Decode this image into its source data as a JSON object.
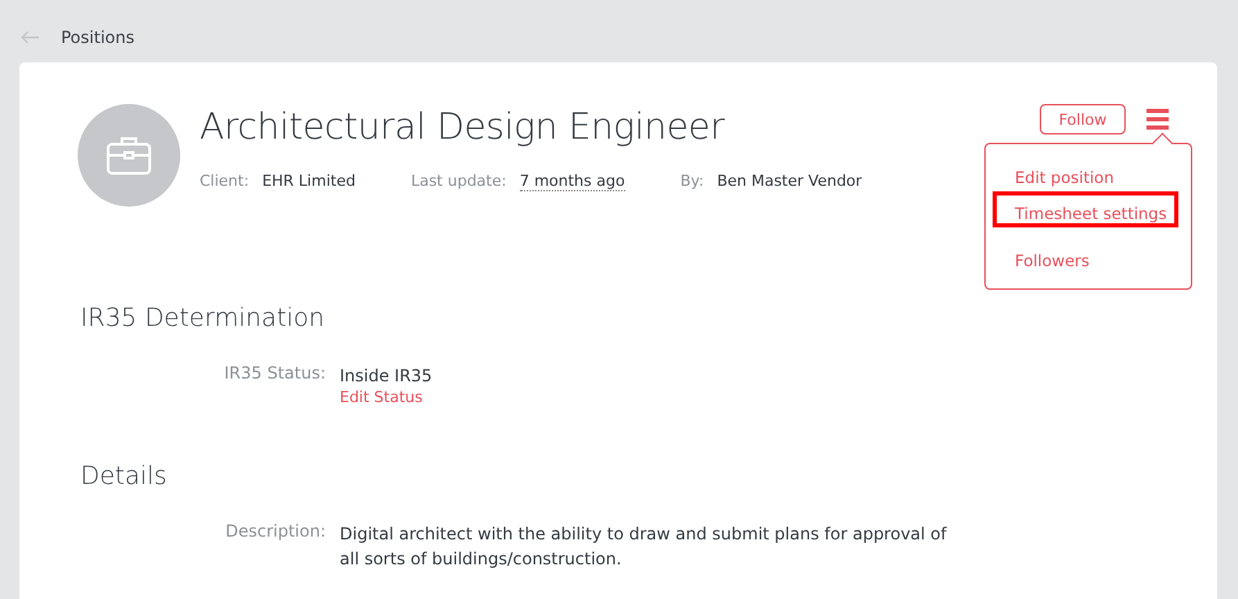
{
  "breadcrumb": {
    "label": "Positions"
  },
  "position": {
    "title": "Architectural Design Engineer",
    "meta": [
      {
        "label": "Client:",
        "value": "EHR Limited",
        "kind": "plain"
      },
      {
        "label": "Last update:",
        "value": "7 months ago",
        "kind": "dotted"
      },
      {
        "label": "By:",
        "value": "Ben Master Vendor",
        "kind": "plain"
      }
    ]
  },
  "actions": {
    "follow": "Follow",
    "menu": {
      "expanded": true,
      "items": [
        {
          "label": "Edit position",
          "highlighted": false
        },
        {
          "label": "Timesheet settings",
          "highlighted": true
        },
        {
          "label": "Followers",
          "highlighted": false
        }
      ]
    }
  },
  "sections": [
    {
      "title": "IR35 Determination",
      "fields": [
        {
          "label": "IR35 Status:",
          "value": "Inside IR35",
          "action": "Edit Status"
        }
      ]
    },
    {
      "title": "Details",
      "fields": [
        {
          "label": "Description:",
          "value": "Digital architect with the ability to draw and submit plans for approval of all sorts of buildings/construction."
        }
      ]
    }
  ]
}
